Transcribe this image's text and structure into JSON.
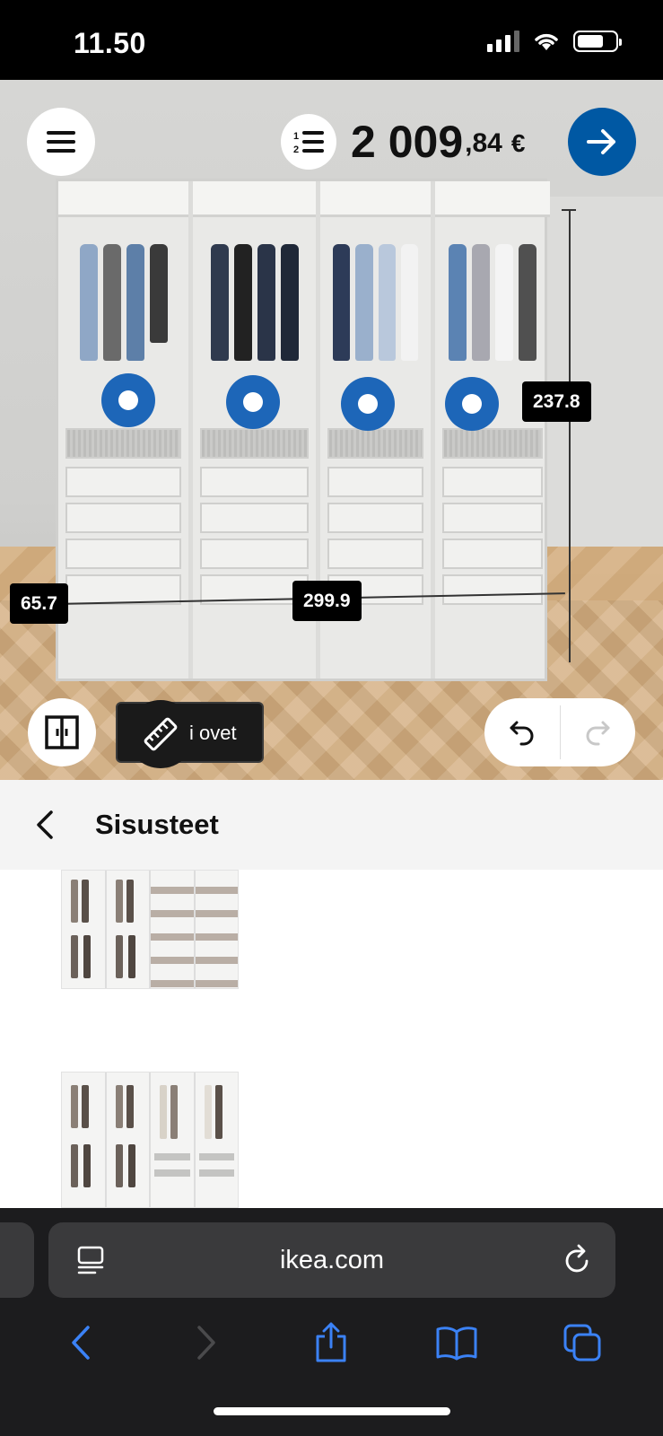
{
  "status_bar": {
    "time": "11.50"
  },
  "planner": {
    "price": {
      "main": "2 009",
      "cents": ",84",
      "currency": "€"
    },
    "dimensions": {
      "depth": "65.7",
      "width": "299.9",
      "height": "237.8"
    },
    "measure_chip_label": "i ovet",
    "icons": {
      "menu": "hamburger-menu-icon",
      "list": "numbered-list-icon",
      "next": "arrow-right-icon",
      "doors": "doors-icon",
      "ruler": "ruler-icon",
      "undo": "undo-icon",
      "redo": "redo-icon"
    },
    "colors": {
      "accent": "#0058a3",
      "hotspot": "#1d66b8"
    }
  },
  "sheet": {
    "title": "Sisusteet",
    "items": [
      {
        "name": "interior-option-1"
      },
      {
        "name": "interior-option-2"
      }
    ]
  },
  "browser": {
    "url": "ikea.com"
  }
}
